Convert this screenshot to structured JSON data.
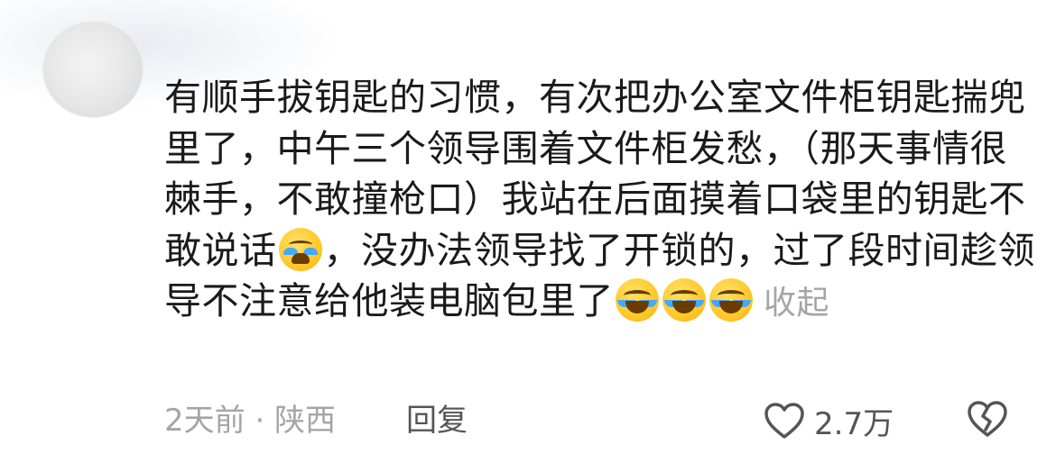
{
  "comment": {
    "segments": [
      {
        "type": "text",
        "value": "有顺手拔钥匙的习惯，有次把办公室文件柜钥匙揣兜里了，中午三个领导围着文件柜发愁，（那天事情很棘手，不敢撞枪口）我站在后面摸着口袋里的钥匙不敢说话"
      },
      {
        "type": "emoji",
        "icon": "crying-emoji-icon"
      },
      {
        "type": "text",
        "value": "，没办法领导找了开锁的，过了段时间趁领导不注意给他装电脑包里了"
      },
      {
        "type": "emoji",
        "icon": "laughing-crying-emoji-icon"
      },
      {
        "type": "emoji",
        "icon": "laughing-crying-emoji-icon"
      },
      {
        "type": "emoji",
        "icon": "laughing-crying-emoji-icon"
      }
    ],
    "collapse_label": "收起"
  },
  "meta": {
    "time_location": "2天前 · 陕西",
    "reply_label": "回复"
  },
  "actions": {
    "like_count": "2.7万",
    "like_icon": "heart-outline-icon",
    "dislike_icon": "broken-heart-icon"
  }
}
